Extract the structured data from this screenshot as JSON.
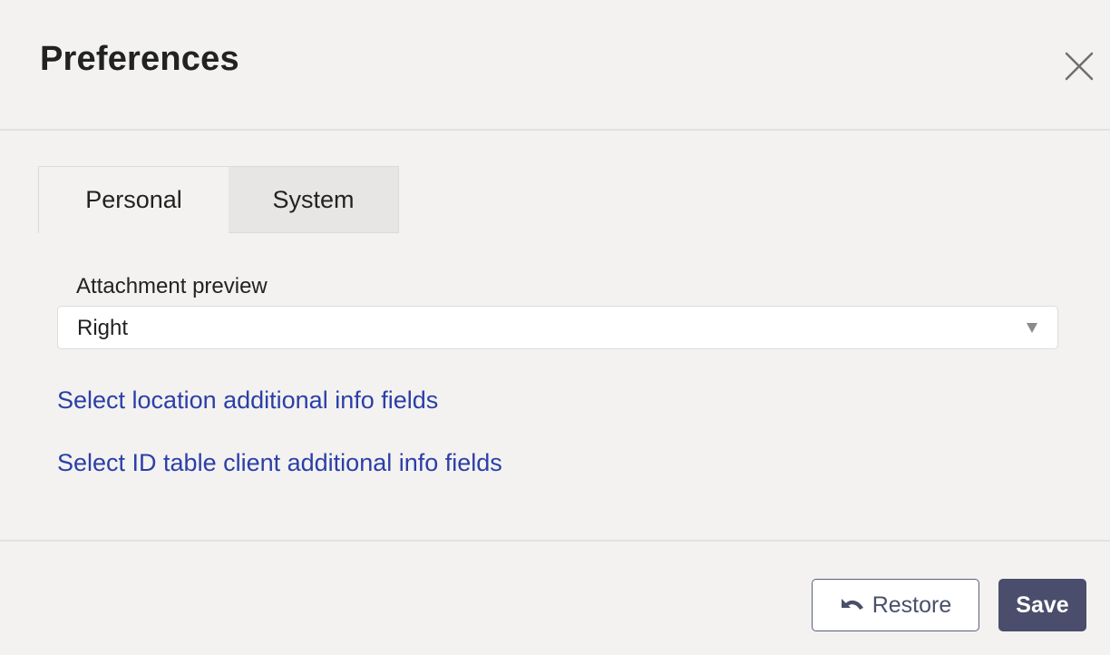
{
  "dialog": {
    "title": "Preferences"
  },
  "tabs": [
    {
      "label": "Personal",
      "active": true
    },
    {
      "label": "System",
      "active": false
    }
  ],
  "attachment_preview": {
    "label": "Attachment preview",
    "value": "Right"
  },
  "links": [
    {
      "label": "Select location additional info fields"
    },
    {
      "label": "Select ID table client additional info fields"
    }
  ],
  "footer": {
    "restore_label": "Restore",
    "save_label": "Save"
  },
  "icons": {
    "close": "close-icon",
    "restore": "undo-icon",
    "dropdown": "dropdown-arrow-icon"
  },
  "colors": {
    "background": "#f3f2f1",
    "link": "#2b3fa6",
    "primary_button": "#4a4e6c",
    "inactive_tab": "#e7e6e5"
  }
}
